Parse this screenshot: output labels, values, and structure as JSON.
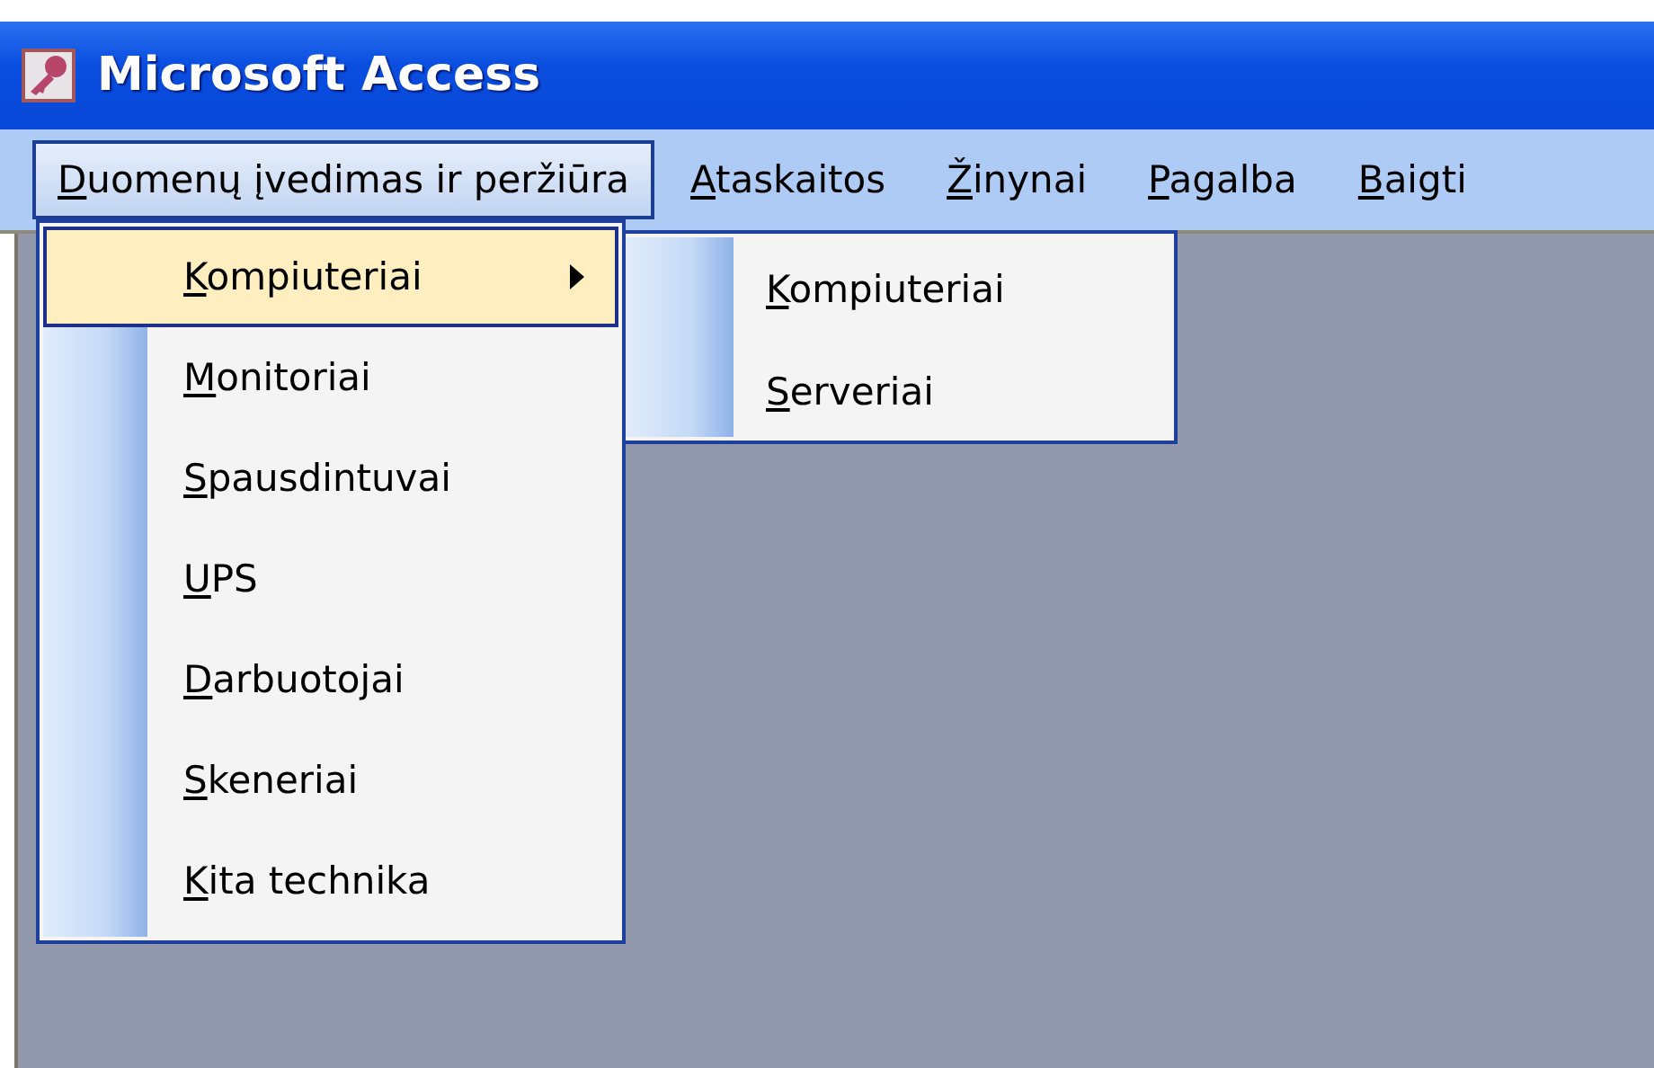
{
  "window": {
    "title": "Microsoft Access"
  },
  "menu_bar": [
    {
      "label": "Duomenų įvedimas ir peržiūra",
      "selected": true
    },
    {
      "label": "Ataskaitos",
      "selected": false
    },
    {
      "label": "Žinynai",
      "selected": false
    },
    {
      "label": "Pagalba",
      "selected": false
    },
    {
      "label": "Baigti",
      "selected": false
    }
  ],
  "dropdown": {
    "items": [
      {
        "label": "Kompiuteriai",
        "selected": true,
        "has_submenu": true
      },
      {
        "label": "Monitoriai",
        "selected": false,
        "has_submenu": false
      },
      {
        "label": "Spausdintuvai",
        "selected": false,
        "has_submenu": false
      },
      {
        "label": "UPS",
        "selected": false,
        "has_submenu": false
      },
      {
        "label": "Darbuotojai",
        "selected": false,
        "has_submenu": false
      },
      {
        "label": "Skeneriai",
        "selected": false,
        "has_submenu": false
      },
      {
        "label": "Kita technika",
        "selected": false,
        "has_submenu": false
      }
    ]
  },
  "submenu": {
    "items": [
      {
        "label": "Kompiuteriai",
        "selected": false
      },
      {
        "label": "Serveriai",
        "selected": false
      }
    ]
  }
}
